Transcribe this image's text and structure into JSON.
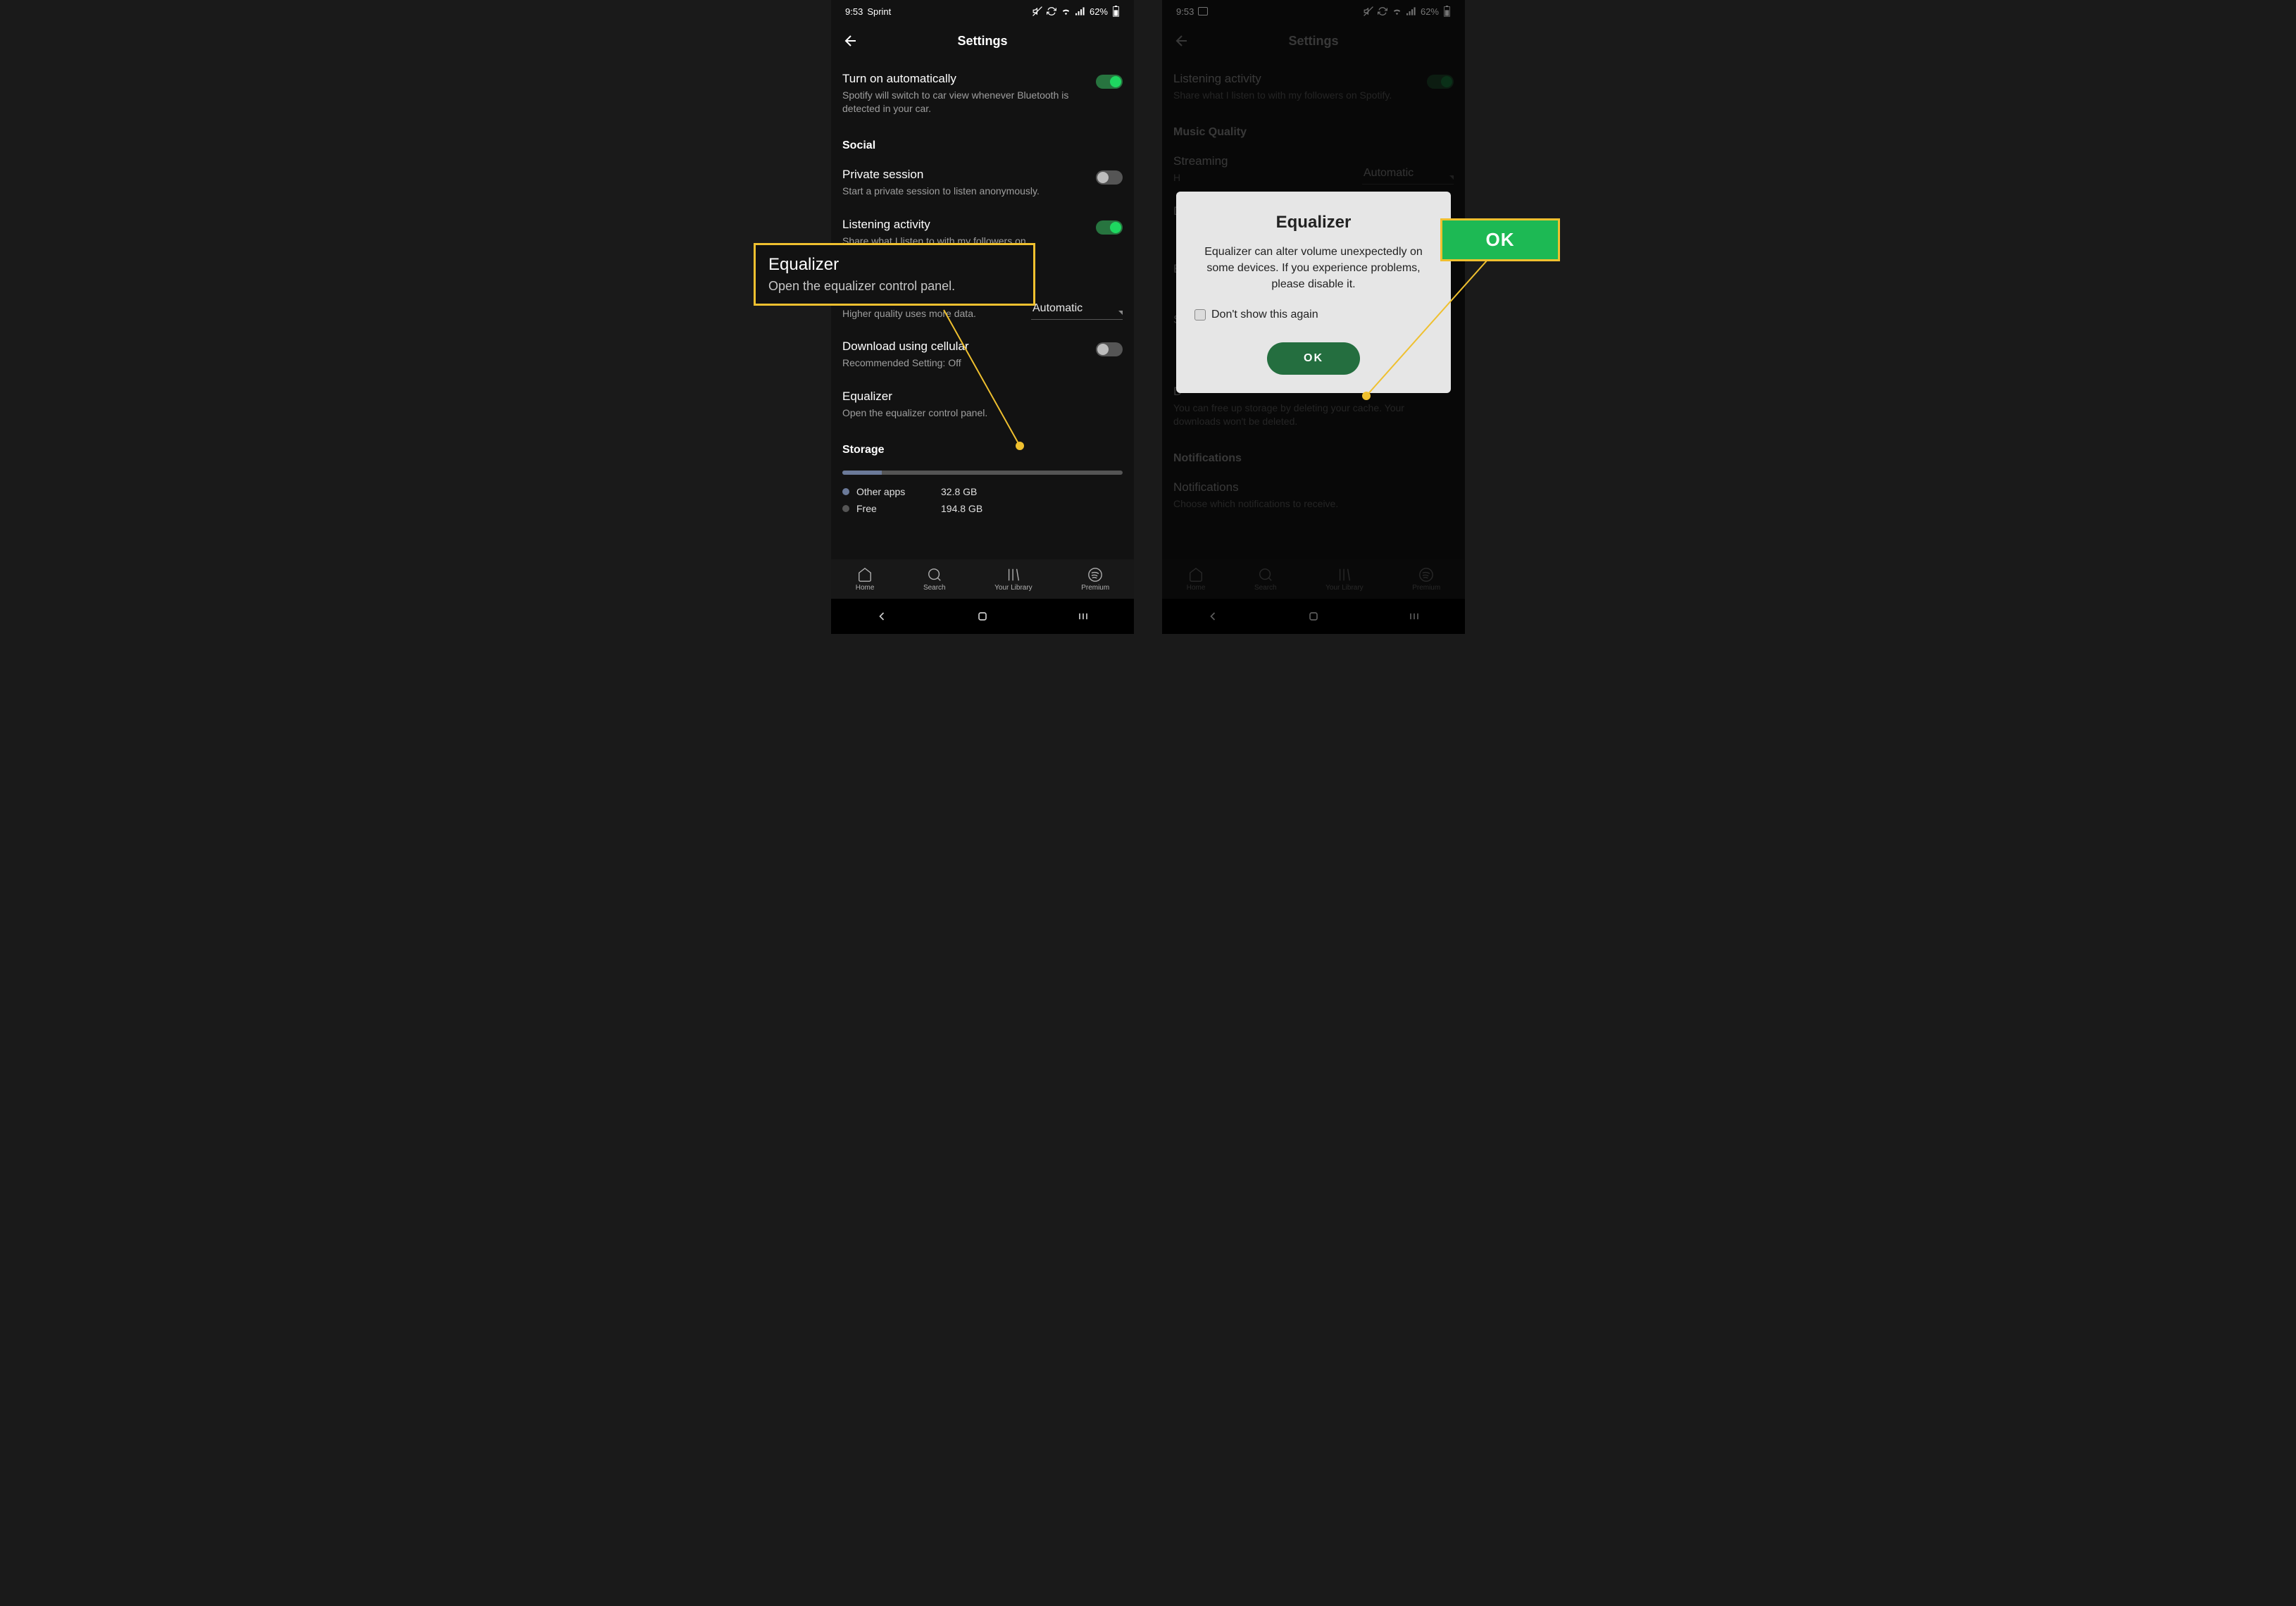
{
  "status": {
    "time": "9:53",
    "carrier": "Sprint",
    "battery": "62%"
  },
  "header": {
    "title": "Settings"
  },
  "left": {
    "autoTitle": "Turn on automatically",
    "autoSub": "Spotify will switch to car view whenever Bluetooth is detected in your car.",
    "socialHeader": "Social",
    "privateTitle": "Private session",
    "privateSub": "Start a private session to listen anonymously.",
    "listenTitle": "Listening activity",
    "listenSub": "Share what I listen to with my followers on",
    "musicHeader": "Music Quality",
    "streamTitle": "Streaming",
    "streamSub": "Higher quality uses more data.",
    "streamValue": "Automatic",
    "dlTitle": "Download using cellular",
    "dlSub": "Recommended Setting: Off",
    "eqTitle": "Equalizer",
    "eqSub": "Open the equalizer control panel.",
    "storageHeader": "Storage",
    "otherLabel": "Other apps",
    "otherVal": "32.8 GB",
    "freeLabel": "Free",
    "freeVal": "194.8 GB"
  },
  "right": {
    "listenTitle": "Listening activity",
    "listenSub": "Share what I listen to with my followers on Spotify.",
    "musicHeader": "Music Quality",
    "streamTitle": "Streaming",
    "streamSubShort": "H",
    "streamValue": "Automatic",
    "dLetter": "D",
    "eLetter": "E",
    "sLetter": "S",
    "cacheSub": "You can free up storage by deleting your cache. Your downloads won't be deleted.",
    "notifHeader": "Notifications",
    "notifTitle": "Notifications",
    "notifSub": "Choose which notifications to receive."
  },
  "dialog": {
    "title": "Equalizer",
    "body": "Equalizer can alter volume unexpectedly on some devices. If you experience problems, please disable it.",
    "checkLabel": "Don't show this again",
    "ok": "OK"
  },
  "nav": {
    "home": "Home",
    "search": "Search",
    "library": "Your Library",
    "premium": "Premium"
  },
  "callout1": {
    "title": "Equalizer",
    "sub": "Open the equalizer control panel."
  },
  "callout2": {
    "label": "OK"
  }
}
